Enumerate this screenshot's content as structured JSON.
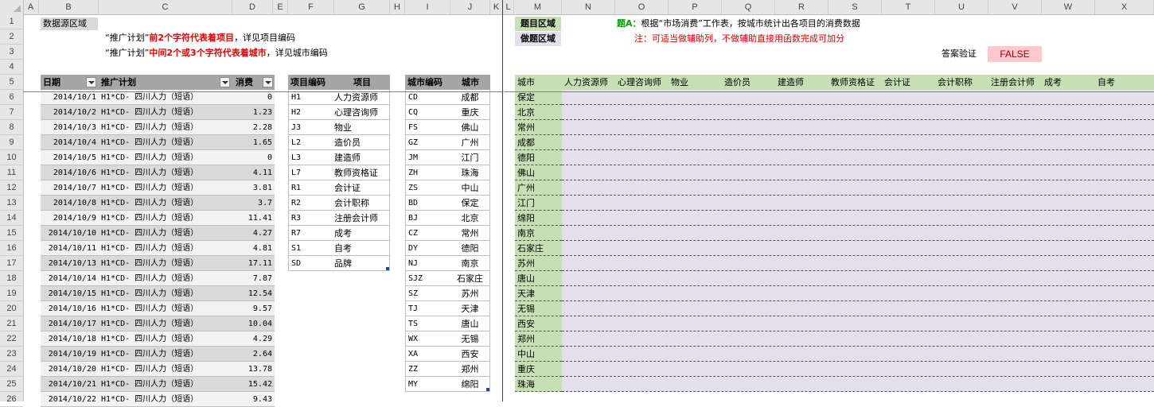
{
  "columns": [
    "A",
    "B",
    "C",
    "D",
    "E",
    "F",
    "G",
    "H",
    "I",
    "J",
    "K",
    "L",
    "M",
    "N",
    "O",
    "P",
    "Q",
    "R",
    "S",
    "T",
    "U",
    "V",
    "W",
    "X"
  ],
  "rows": [
    "1",
    "2",
    "3",
    "4",
    "5",
    "6",
    "7",
    "8",
    "9",
    "10",
    "11",
    "12",
    "13",
    "14",
    "15",
    "16",
    "17",
    "18",
    "19",
    "20",
    "21",
    "22",
    "23",
    "24",
    "25",
    "26"
  ],
  "labels": {
    "source_area": "数据源区域",
    "note1_prefix": "“推广计划”",
    "note1_bold": "前2个字符代表着项目",
    "note1_suffix": "，详见项目编码",
    "note2_prefix": "“推广计划”",
    "note2_bold": "中间2个或3个字符代表着城市",
    "note2_suffix": "，详见城市编码",
    "question_area": "题目区域",
    "answer_area": "做题区域",
    "question_prefix": "题A：",
    "question_text": "根据“市场消费”工作表，按城市统计出各项目的消费数据",
    "question_note": "注：可适当做辅助列，不做辅助直接用函数完成可加分",
    "verify_label": "答案验证",
    "verify_value": "FALSE"
  },
  "data_table": {
    "headers": [
      "日期",
      "推广计划",
      "消费"
    ],
    "rows": [
      [
        "2014/10/1",
        "H1*CD- 四川人力（短语）",
        "0"
      ],
      [
        "2014/10/2",
        "H1*CD- 四川人力（短语）",
        "1.23"
      ],
      [
        "2014/10/3",
        "H1*CD- 四川人力（短语）",
        "2.28"
      ],
      [
        "2014/10/4",
        "H1*CD- 四川人力（短语）",
        "1.65"
      ],
      [
        "2014/10/5",
        "H1*CD- 四川人力（短语）",
        "0"
      ],
      [
        "2014/10/6",
        "H1*CD- 四川人力（短语）",
        "4.11"
      ],
      [
        "2014/10/7",
        "H1*CD- 四川人力（短语）",
        "3.81"
      ],
      [
        "2014/10/8",
        "H1*CD- 四川人力（短语）",
        "3.7"
      ],
      [
        "2014/10/9",
        "H1*CD- 四川人力（短语）",
        "11.41"
      ],
      [
        "2014/10/10",
        "H1*CD- 四川人力（短语）",
        "4.27"
      ],
      [
        "2014/10/11",
        "H1*CD- 四川人力（短语）",
        "4.81"
      ],
      [
        "2014/10/13",
        "H1*CD- 四川人力（短语）",
        "17.11"
      ],
      [
        "2014/10/14",
        "H1*CD- 四川人力（短语）",
        "7.87"
      ],
      [
        "2014/10/15",
        "H1*CD- 四川人力（短语）",
        "12.54"
      ],
      [
        "2014/10/16",
        "H1*CD- 四川人力（短语）",
        "9.57"
      ],
      [
        "2014/10/17",
        "H1*CD- 四川人力（短语）",
        "10.04"
      ],
      [
        "2014/10/18",
        "H1*CD- 四川人力（短语）",
        "4.29"
      ],
      [
        "2014/10/19",
        "H1*CD- 四川人力（短语）",
        "2.64"
      ],
      [
        "2014/10/20",
        "H1*CD- 四川人力（短语）",
        "13.78"
      ],
      [
        "2014/10/21",
        "H1*CD- 四川人力（短语）",
        "15.42"
      ],
      [
        "2014/10/22",
        "H1*CD- 四川人力（短语）",
        "9.43"
      ]
    ]
  },
  "project_table": {
    "headers": [
      "项目编码",
      "项目"
    ],
    "rows": [
      [
        "H1",
        "人力资源师"
      ],
      [
        "H2",
        "心理咨询师"
      ],
      [
        "J3",
        "物业"
      ],
      [
        "L2",
        "造价员"
      ],
      [
        "L3",
        "建造师"
      ],
      [
        "L7",
        "教师资格证"
      ],
      [
        "R1",
        "会计证"
      ],
      [
        "R2",
        "会计职称"
      ],
      [
        "R3",
        "注册会计师"
      ],
      [
        "R7",
        "成考"
      ],
      [
        "S1",
        "自考"
      ],
      [
        "SD",
        "品牌"
      ]
    ]
  },
  "city_table": {
    "headers": [
      "城市编码",
      "城市"
    ],
    "rows": [
      [
        "CD",
        "成都"
      ],
      [
        "CQ",
        "重庆"
      ],
      [
        "FS",
        "佛山"
      ],
      [
        "GZ",
        "广州"
      ],
      [
        "JM",
        "江门"
      ],
      [
        "ZH",
        "珠海"
      ],
      [
        "ZS",
        "中山"
      ],
      [
        "BD",
        "保定"
      ],
      [
        "BJ",
        "北京"
      ],
      [
        "CZ",
        "常州"
      ],
      [
        "DY",
        "德阳"
      ],
      [
        "NJ",
        "南京"
      ],
      [
        "SJZ",
        "石家庄"
      ],
      [
        "SZ",
        "苏州"
      ],
      [
        "TJ",
        "天津"
      ],
      [
        "TS",
        "唐山"
      ],
      [
        "WX",
        "无锡"
      ],
      [
        "XA",
        "西安"
      ],
      [
        "ZZ",
        "郑州"
      ],
      [
        "MY",
        "绵阳"
      ]
    ]
  },
  "answer_table": {
    "headers": [
      "城市",
      "人力资源师",
      "心理咨询师",
      "物业",
      "造价员",
      "建造师",
      "教师资格证",
      "会计证",
      "会计职称",
      "注册会计师",
      "成考",
      "自考"
    ],
    "cities": [
      "保定",
      "北京",
      "常州",
      "成都",
      "德阳",
      "佛山",
      "广州",
      "江门",
      "绵阳",
      "南京",
      "石家庄",
      "苏州",
      "唐山",
      "天津",
      "无锡",
      "西安",
      "郑州",
      "中山",
      "重庆",
      "珠海"
    ]
  },
  "colors": {
    "header_gray": "#a6a6a6",
    "cell_gray": "#d9d9d9",
    "answer_green": "#c6e0b4",
    "answer_lavender": "#e4dfec",
    "false_bg": "#ffc7ce",
    "false_text": "#9c0006"
  }
}
